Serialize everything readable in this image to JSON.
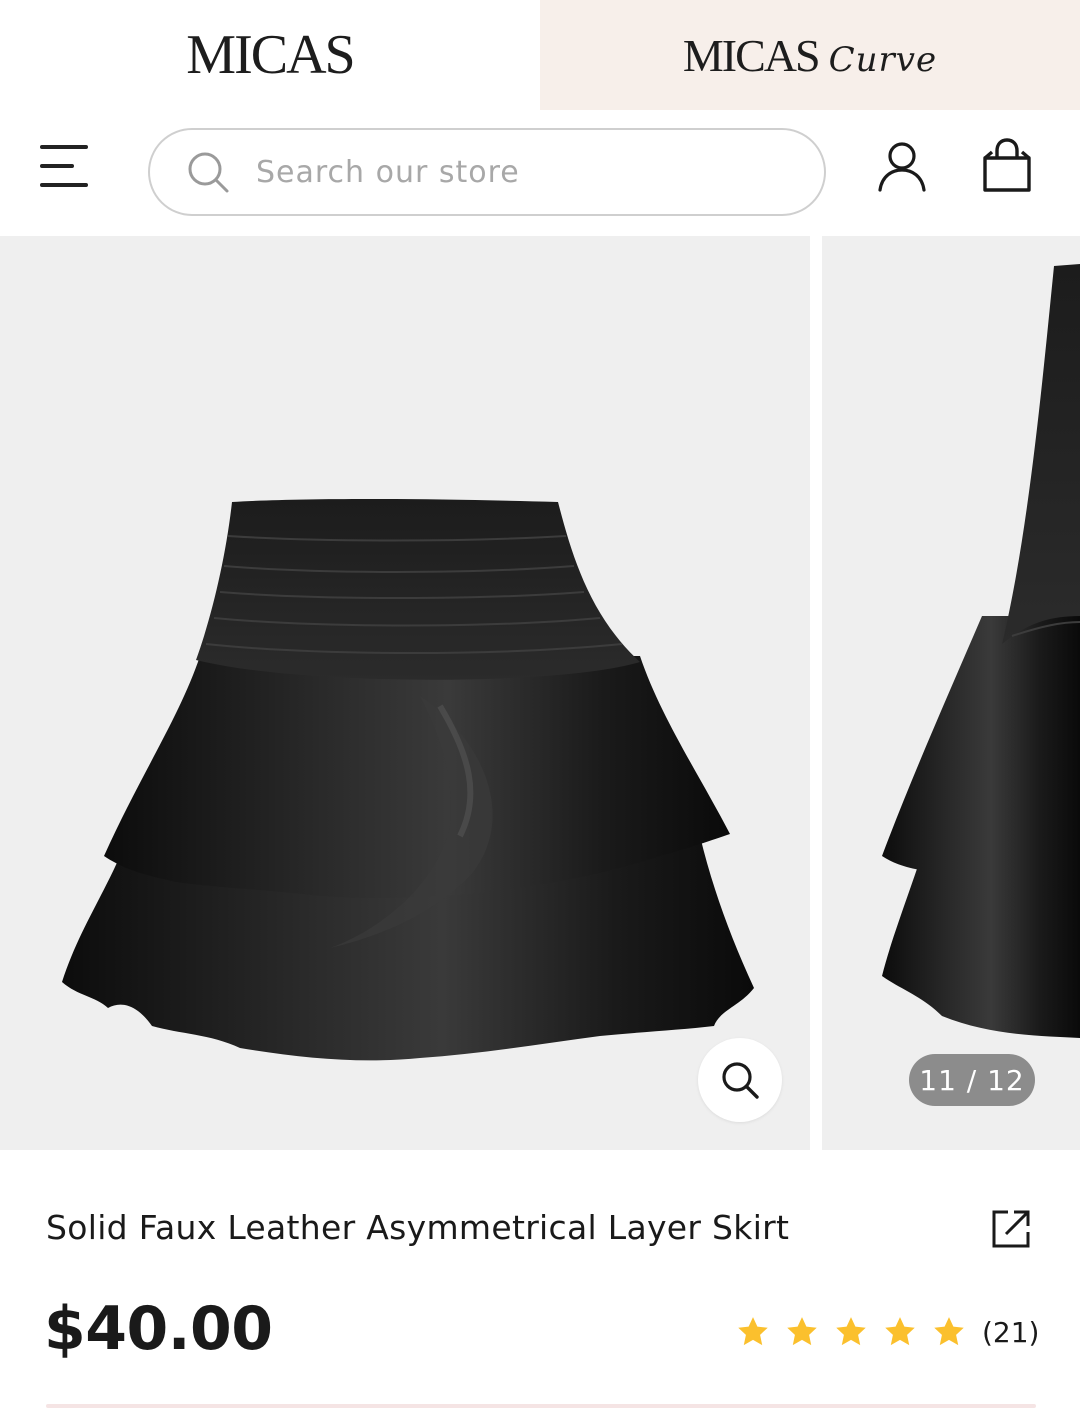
{
  "brands": {
    "micas": "MICAS",
    "curve_main": "MICAS",
    "curve_script": "Curve"
  },
  "header": {
    "menu_icon": "hamburger-menu-icon",
    "search_placeholder": "Search our store",
    "account_icon": "user-icon",
    "cart_icon": "shopping-bag-icon"
  },
  "gallery": {
    "counter": "11 / 12",
    "zoom_icon": "magnifier-icon"
  },
  "product": {
    "title": "Solid Faux Leather Asymmetrical Layer Skirt",
    "price": "$40.00",
    "rating": 5,
    "review_count": "(21)",
    "share_icon": "external-share-icon"
  },
  "colors": {
    "curve_tab_bg": "#f7efea",
    "gallery_bg": "#efefef",
    "star": "#fbc02d",
    "counter_bg": "#8c8c8c"
  }
}
